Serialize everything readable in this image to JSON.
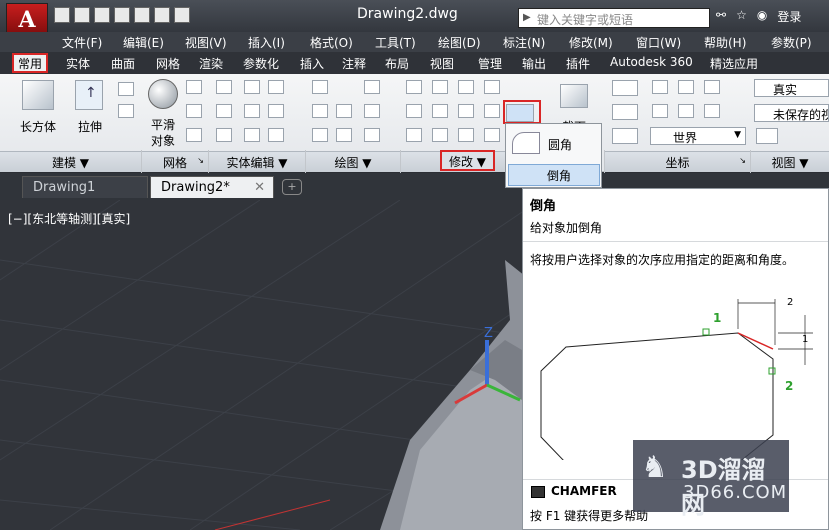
{
  "title": {
    "document": "Drawing2.dwg",
    "search_placeholder": "键入关键字或短语",
    "login": "登录"
  },
  "app_logo": "A",
  "menu": [
    "文件(F)",
    "编辑(E)",
    "视图(V)",
    "插入(I)",
    "格式(O)",
    "工具(T)",
    "绘图(D)",
    "标注(N)",
    "修改(M)",
    "窗口(W)",
    "帮助(H)",
    "参数(P)"
  ],
  "ribbon_tabs": [
    "常用",
    "实体",
    "曲面",
    "网格",
    "渲染",
    "参数化",
    "插入",
    "注释",
    "布局",
    "视图",
    "管理",
    "输出",
    "插件",
    "Autodesk 360",
    "精选应用"
  ],
  "ribbon_tools": {
    "box": "长方体",
    "extrude": "拉伸",
    "smooth_line1": "平滑",
    "smooth_line2": "对象",
    "section": "截面",
    "visual_style": "真实",
    "unsaved_view": "未保存的视",
    "world": "世界"
  },
  "panels": {
    "modeling": "建模 ▼",
    "mesh": "网格",
    "solid_edit": "实体编辑 ▼",
    "draw": "绘图 ▼",
    "modify": "修改 ▼",
    "coordinates": "坐标",
    "view": "视图 ▼"
  },
  "doc_tabs": [
    "Drawing1",
    "Drawing2*"
  ],
  "viewport_label": "[−][东北等轴测][真实]",
  "dropdown": {
    "fillet": "圆角",
    "chamfer": "倒角"
  },
  "tooltip": {
    "title": "倒角",
    "subtitle": "给对象加倒角",
    "description": "将按用户选择对象的次序应用指定的距离和角度。",
    "dim_top": "2",
    "dim_right": "1",
    "marker1": "1",
    "marker2": "2",
    "command": "CHAMFER",
    "help": "按 F1 键获得更多帮助"
  },
  "watermark": {
    "line1": "3D溜溜网",
    "line2": "3D66.COM"
  },
  "colors": {
    "highlight": "#d92626",
    "ucs_x": "#d93a3a",
    "ucs_y": "#3ab53a",
    "ucs_z": "#3a6fd9"
  }
}
